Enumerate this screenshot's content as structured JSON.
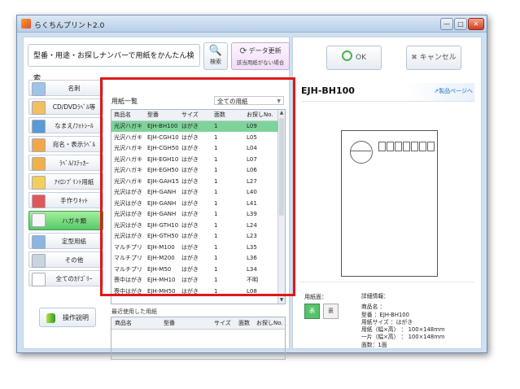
{
  "window": {
    "title": "らくちんプリント2.0",
    "controls": [
      "—",
      "□",
      "✕"
    ]
  },
  "search": {
    "value": "型番・用途・お探しナンバーで用紙をかんたん検索",
    "button_label": "検索",
    "icon": "search-icon"
  },
  "update": {
    "label": "データ更新",
    "sub": "該当用紙がない場合",
    "icon": "refresh-icon"
  },
  "categories": [
    {
      "label": "名刺",
      "color": "#9fc4e8"
    },
    {
      "label": "CD/DVDﾗﾍﾞﾙ等",
      "color": "#f2c060"
    },
    {
      "label": "なまえ/ﾌｫﾄｼｰﾙ",
      "color": "#5a9ad6"
    },
    {
      "label": "宛名・表示ﾗﾍﾞﾙ",
      "color": "#f4a64a"
    },
    {
      "label": "ﾗﾍﾞﾙ/ｽﾃｯｶｰ",
      "color": "#f0b04a"
    },
    {
      "label": "ｱｲﾛﾝﾌﾟﾘﾝﾄ用紙",
      "color": "#f2cf5a"
    },
    {
      "label": "手作りｷｯﾄ",
      "color": "#e15757"
    },
    {
      "label": "ハガキ類",
      "color": "#f7f7f7",
      "active": true
    },
    {
      "label": "定型用紙",
      "color": "#8ab6e0"
    },
    {
      "label": "その他",
      "color": "#c9d4df"
    },
    {
      "label": "全てのｶﾃｺﾞﾘｰ",
      "color": "#ffffff"
    }
  ],
  "help_button": "操作説明",
  "paper_list": {
    "title": "用紙一覧",
    "filter": "全ての用紙",
    "columns": [
      "商品名",
      "型番",
      "サイズ",
      "面数",
      "お探しNo."
    ],
    "rows": [
      [
        "光沢ハガキ",
        "EJH-BH100",
        "はがき",
        "1",
        "L09"
      ],
      [
        "光沢ハガキ",
        "EJH-CGH10",
        "はがき",
        "1",
        "L05"
      ],
      [
        "光沢ハガキ",
        "EJH-CGH50",
        "はがき",
        "1",
        "L04"
      ],
      [
        "光沢ハガキ",
        "EJH-EGH10",
        "はがき",
        "1",
        "L07"
      ],
      [
        "光沢ハガキ",
        "EJH-EGH50",
        "はがき",
        "1",
        "L06"
      ],
      [
        "光沢ハガキ",
        "EJH-GAH15",
        "はがき",
        "1",
        "L27"
      ],
      [
        "光沢はがき",
        "EJH-GANH",
        "はがき",
        "1",
        "L40"
      ],
      [
        "光沢はがき",
        "EJH-GANH",
        "はがき",
        "1",
        "L41"
      ],
      [
        "光沢はがき",
        "EJH-GANH",
        "はがき",
        "1",
        "L39"
      ],
      [
        "光沢はがき",
        "EJH-GTH10",
        "はがき",
        "1",
        "L24"
      ],
      [
        "光沢はがき",
        "EJH-GTH50",
        "はがき",
        "1",
        "L23"
      ],
      [
        "マルチプリ",
        "EJH-M100",
        "はがき",
        "1",
        "L35"
      ],
      [
        "マルチプリ",
        "EJH-M200",
        "はがき",
        "1",
        "L36"
      ],
      [
        "マルチプリ",
        "EJH-M50",
        "はがき",
        "1",
        "L34"
      ],
      [
        "喪中はがき",
        "EJH-MH10",
        "はがき",
        "1",
        "不明"
      ],
      [
        "喪中はがき",
        "EJH-MH50",
        "はがき",
        "1",
        "L08"
      ]
    ]
  },
  "recent": {
    "label": "最近使用した用紙",
    "columns": [
      "商品名",
      "型番",
      "サイズ",
      "面数",
      "お探しNo."
    ]
  },
  "buttons": {
    "ok": "OK",
    "cancel": "キャンセル"
  },
  "product": {
    "model": "EJH-BH100",
    "link": "製品ページへ"
  },
  "paper_side": {
    "label": "用紙面：",
    "front": "表",
    "back": "裏"
  },
  "details": {
    "title": "詳細情報：",
    "lines": [
      "商品名 ：",
      "型番 ：EJH-BH100",
      "用紙サイズ ：はがき",
      "用紙（幅×高） ： 100×148mm",
      "一片（幅×高） ： 100×148mm",
      "面数：1面"
    ]
  },
  "accent_colors": {
    "highlight": "#e0191b",
    "selected_row": "#7dd39a",
    "active_category": "#55c96a"
  }
}
